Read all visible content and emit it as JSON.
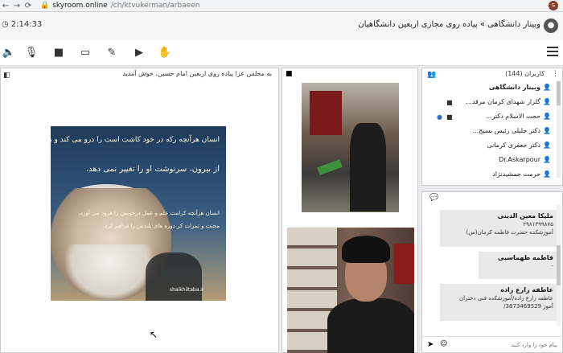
{
  "browser": {
    "url_domain": "skyroom.online",
    "url_path": "/ch/ktvukerman/arbaeen",
    "avatar_letter": "S"
  },
  "header": {
    "timer": "2:14:33",
    "title": "وبینار دانشگاهی » پیاده روی مجازی اربعین دانشگاهیان"
  },
  "presentation": {
    "title": "به مجلس عزا پیاده روی اربعین امام حسین، خوش آمدید",
    "poster_lines": [
      "انسان هرآنچه رکه در خود کاشت است را درو می کند و هیچ نیرو",
      "از بیرون، سرنوشت او را تغییر نمی دهد.",
      "انسان هرآنچه کرامت علم و عمل درخویش را فرود می آورد،",
      "محنت و ثمرات کر دوره های بلندش را فراهم کرد."
    ],
    "poster_watermark": "shaikhiltaba.ir"
  },
  "users": {
    "title": "کاربران (144)",
    "list": [
      {
        "name": "وبینار دانشگاهی",
        "icon_color": "blue"
      },
      {
        "name": "گلزار شهدای کرمان مرقد...",
        "icon_color": "blue"
      },
      {
        "name": "حجت الاسلام دکتر...",
        "icon_color": "blue"
      },
      {
        "name": "دکتر جلیلی رئیس بسیج...",
        "icon_color": "blue"
      },
      {
        "name": "دکتر جعفری کرمانی",
        "icon_color": "blue"
      },
      {
        "name": "Dr.Askarpour",
        "icon_color": "blue"
      },
      {
        "name": "حرمت جمشیدنژاد",
        "icon_color": "yellow"
      }
    ]
  },
  "chat": {
    "messages": [
      {
        "name": "ملیکا معین الدینی",
        "lines": [
          "۲۹۸۱۳۹۹۸۷۵",
          "آموزشکده حضرت فاطمه کرمان(س)"
        ]
      },
      {
        "name": "فاطمه طهماسبی",
        "lines": [
          "-"
        ]
      },
      {
        "name": "عاطفه زارع زاده",
        "lines": [
          "عاطفه زارع زاده/آموزشکده فنی دختران",
          "آموز 3873469529/"
        ]
      }
    ],
    "input_placeholder": "پیام خود را وارد کنید"
  }
}
